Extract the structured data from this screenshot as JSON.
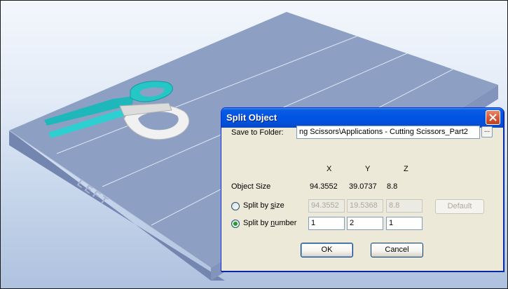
{
  "scene": {
    "platform_label": "LEFT",
    "colors": {
      "platform_top": "#8c9fc3",
      "platform_side": "#6e83ad",
      "scissors_cyan": "#20c3c3",
      "scissors_white": "#ececec"
    }
  },
  "dialog": {
    "title": "Split Object",
    "save_to_folder_label": "Save to Folder:",
    "folder_path": "ng Scissors\\Applications - Cutting Scissors_Part2",
    "browse_label": "...",
    "axes": {
      "x": "X",
      "y": "Y",
      "z": "Z"
    },
    "object_size_label": "Object Size",
    "object_size": {
      "x": "94.3552",
      "y": "39.0737",
      "z": "8.8"
    },
    "split_by_size": {
      "label_prefix": "Split by ",
      "label_key": "s",
      "label_rest": "ize",
      "selected": false,
      "x": "94.3552",
      "y": "19.5368",
      "z": "8.8"
    },
    "default_button": "Default",
    "split_by_number": {
      "label_prefix": "Split by ",
      "label_key": "n",
      "label_rest": "umber",
      "selected": true,
      "x": "1",
      "y": "2",
      "z": "1"
    },
    "ok_button": "OK",
    "cancel_button": "Cancel"
  }
}
